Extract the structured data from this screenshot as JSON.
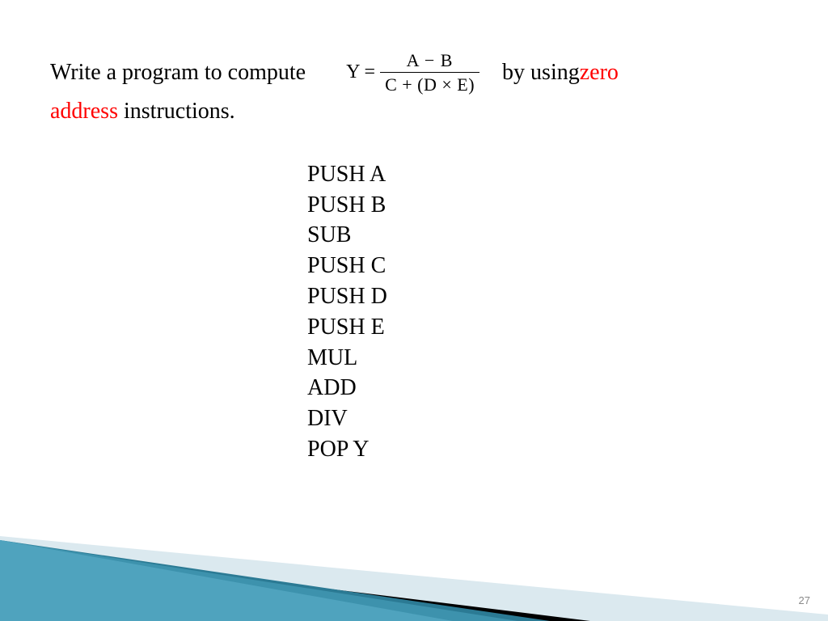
{
  "prompt": {
    "part1": "Write a program to compute",
    "part2": " by using ",
    "highlight1": "zero",
    "highlight2": "address",
    "part3": " instructions."
  },
  "formula": {
    "lhs": "Y =",
    "numerator": "A − B",
    "denominator": "C + (D × E)"
  },
  "instructions": [
    "PUSH A",
    "PUSH B",
    "SUB",
    "PUSH C",
    "PUSH D",
    "PUSH E",
    "MUL",
    "ADD",
    "DIV",
    "POP Y"
  ],
  "page_number": "27"
}
